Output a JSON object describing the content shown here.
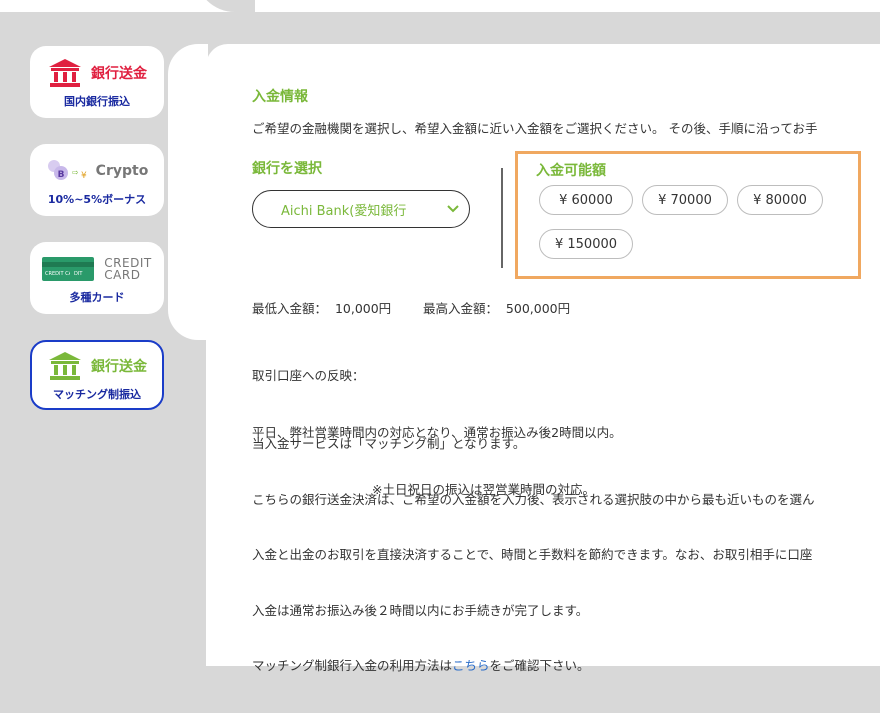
{
  "sidebar": {
    "tabs": [
      {
        "title": "銀行送金",
        "sub": "国内銀行振込",
        "icon": "bank-icon",
        "color": "#e02040"
      },
      {
        "title": "Crypto",
        "sub": "10%~5%ボーナス",
        "icon": "crypto-icon",
        "color": "#777777"
      },
      {
        "title": "CREDIT\nCARD",
        "sub": "多種カード",
        "icon": "credit-card-icon",
        "color": "#777777",
        "card_text": "CREDIT CARD"
      },
      {
        "title": "銀行送金",
        "sub": "マッチング制振込",
        "icon": "bank-icon",
        "color": "#7ab83a",
        "active": true
      }
    ]
  },
  "main": {
    "section_title": "入金情報",
    "intro": "ご希望の金融機関を選択し、希望入金額に近い入金額をご選択ください。 その後、手順に沿ってお手",
    "bank_heading": "銀行を選択",
    "bank_selected": "Aichi Bank(愛知銀行",
    "amount_heading": "入金可能額",
    "amounts": [
      "¥ 60000",
      "¥ 70000",
      "¥ 80000",
      "¥ 150000"
    ],
    "limits": "最低入金額：  10,000円        最高入金額：  500,000円",
    "reflect_title": "取引口座への反映：",
    "reflect_line1": "平日、弊社営業時間内の対応となり、通常お振込み後2時間以内。",
    "reflect_line2": "※土日祝日の振込は翌営業時間の対応。",
    "service_lines": [
      "当入金サービスは「マッチング制」となります。",
      "こちらの銀行送金決済は、ご希望の入金額を入力後、表示される選択肢の中から最も近いものを選ん",
      "入金と出金のお取引を直接決済することで、時間と手数料を節約できます。なお、お取引相手に口座",
      "入金は通常お振込み後２時間以内にお手続きが完了します。"
    ],
    "howto_prefix": "マッチング制銀行入金の利用方法は",
    "howto_link": "こちら",
    "howto_suffix": "をご確認下さい。"
  },
  "colors": {
    "accent_green": "#7ab83a",
    "bank_red": "#e02040",
    "highlight_orange": "#f0a860",
    "active_blue": "#1a3cc8"
  }
}
